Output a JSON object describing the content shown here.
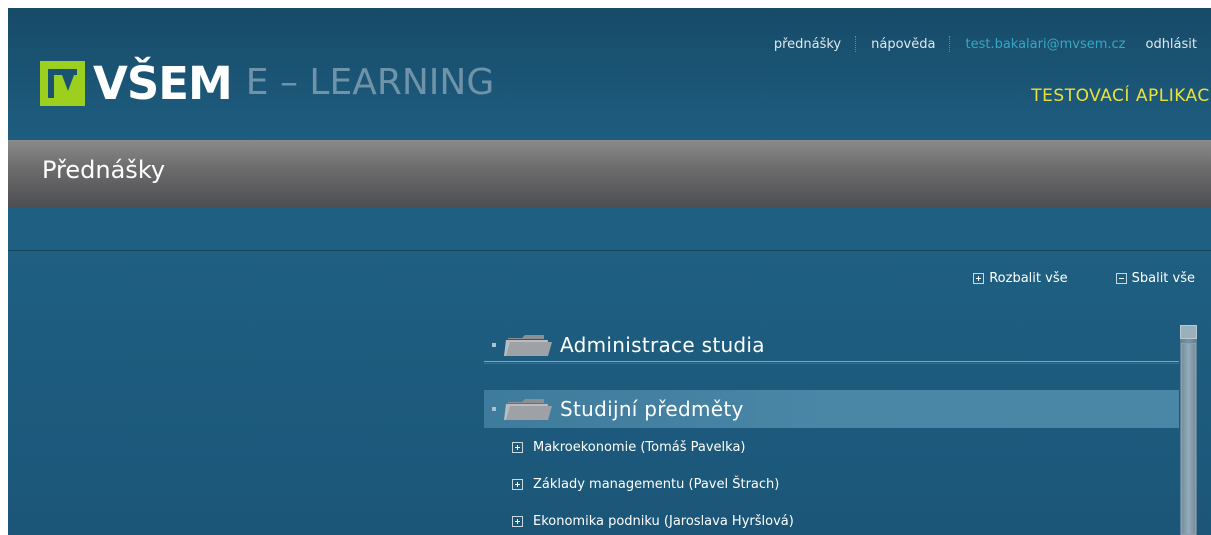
{
  "header": {
    "logo_brand": "VŠEM",
    "logo_sub": "E – LEARNING",
    "nav": {
      "lectures": "přednášky",
      "help": "nápověda",
      "user_email": "test.bakalari@mvsem.cz",
      "logout": "odhlásit"
    },
    "app_tag": "TESTOVACÍ APLIKACE"
  },
  "page": {
    "title": "Přednášky"
  },
  "actions": {
    "expand_all": "Rozbalit vše",
    "collapse_all": "Sbalit vše"
  },
  "tree": {
    "categories": [
      {
        "label": "Administrace studia"
      },
      {
        "label": "Studijní předměty"
      }
    ],
    "courses": [
      {
        "label": "Makroekonomie  (Tomáš Pavelka)"
      },
      {
        "label": "Základy managementu  (Pavel Štrach)"
      },
      {
        "label": "Ekonomika podniku  (Jaroslava Hyršlová)"
      }
    ]
  },
  "colors": {
    "accent_green": "#9ccf1e",
    "app_tag_yellow": "#e8e23a",
    "email_link": "#36a8c4",
    "background_blue": "#1c5a7c"
  },
  "icons": [
    "vsem-logo-mark",
    "folder-icon",
    "plus-box-icon",
    "minus-box-icon",
    "bullet-icon"
  ]
}
